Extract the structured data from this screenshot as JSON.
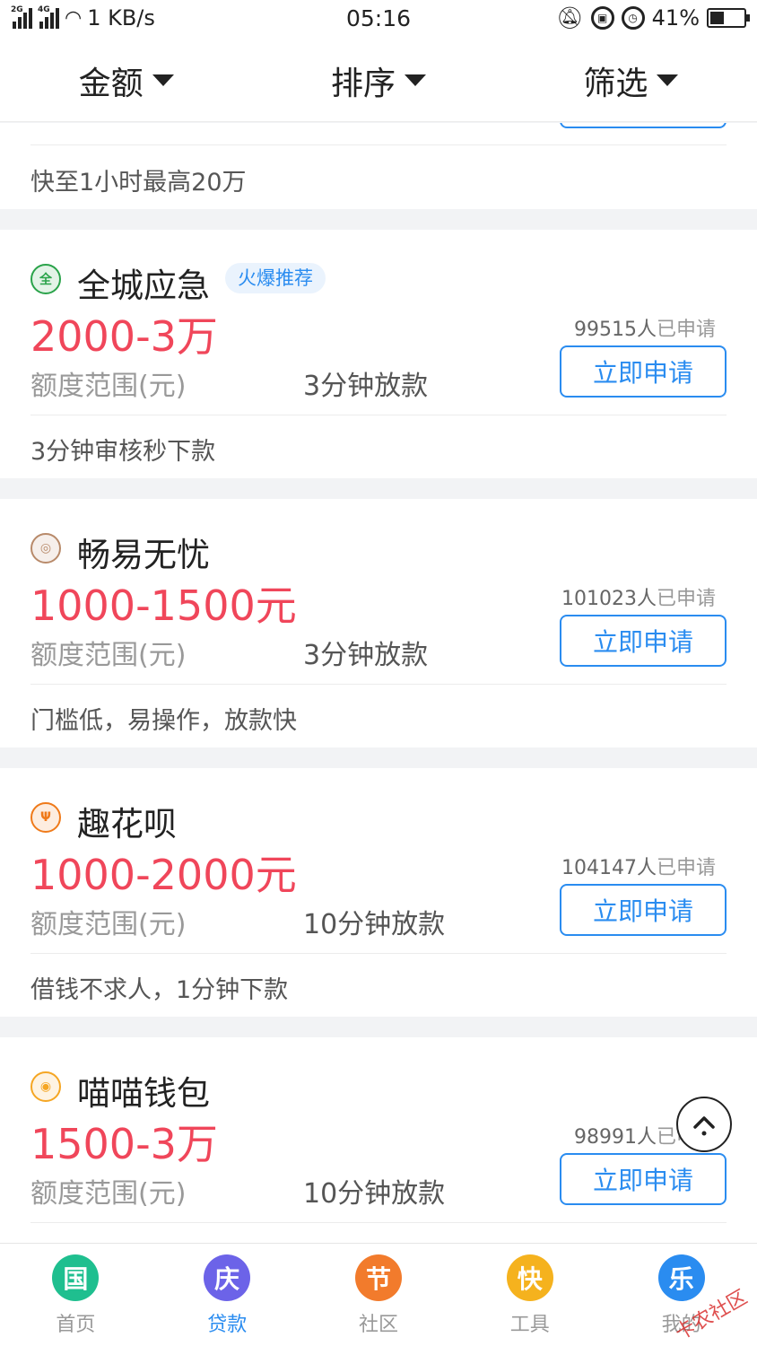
{
  "status_bar": {
    "net_1": "2G",
    "net_2": "4G",
    "speed": "1 KB/s",
    "time": "05:16",
    "battery": "41%",
    "battery_level": 0.41
  },
  "filters": [
    {
      "label": "金额"
    },
    {
      "label": "排序"
    },
    {
      "label": "筛选"
    }
  ],
  "partial_card": {
    "description": "快至1小时最高20万"
  },
  "products": [
    {
      "logo_glyph": "全",
      "logo_color": "#2aa34a",
      "name": "全城应急",
      "badge": "火爆推荐",
      "amount": "2000-3万",
      "amount_label": "额度范围(元)",
      "speed": "3分钟放款",
      "count": "99515人",
      "count_suffix": "已申请",
      "button": "立即申请",
      "description": "3分钟审核秒下款"
    },
    {
      "logo_glyph": "◎",
      "logo_color": "#b88a6a",
      "name": "畅易无忧",
      "badge": "",
      "amount": "1000-1500元",
      "amount_label": "额度范围(元)",
      "speed": "3分钟放款",
      "count": "101023人",
      "count_suffix": "已申请",
      "button": "立即申请",
      "description": "门槛低，易操作，放款快"
    },
    {
      "logo_glyph": "Ψ",
      "logo_color": "#ef7a1a",
      "name": "趣花呗",
      "badge": "",
      "amount": "1000-2000元",
      "amount_label": "额度范围(元)",
      "speed": "10分钟放款",
      "count": "104147人",
      "count_suffix": "已申请",
      "button": "立即申请",
      "description": "借钱不求人，1分钟下款"
    },
    {
      "logo_glyph": "◉",
      "logo_color": "#f5a623",
      "name": "喵喵钱包",
      "badge": "",
      "amount": "1500-3万",
      "amount_label": "额度范围(元)",
      "speed": "10分钟放款",
      "count": "98991人",
      "count_suffix": "已申请",
      "button": "立即申请",
      "description": ""
    }
  ],
  "tabs": [
    {
      "glyph": "国",
      "label": "首页",
      "color": "#1fbf8f"
    },
    {
      "glyph": "庆",
      "label": "贷款",
      "color": "#6c63e8"
    },
    {
      "glyph": "节",
      "label": "社区",
      "color": "#f27b2c"
    },
    {
      "glyph": "快",
      "label": "工具",
      "color": "#f5b21e"
    },
    {
      "glyph": "乐",
      "label": "我的",
      "color": "#2a8cf0"
    }
  ],
  "active_tab": "贷款",
  "accent_color": "#2a8cf0",
  "amount_color": "#f0465a",
  "watermark": "卡农社区"
}
